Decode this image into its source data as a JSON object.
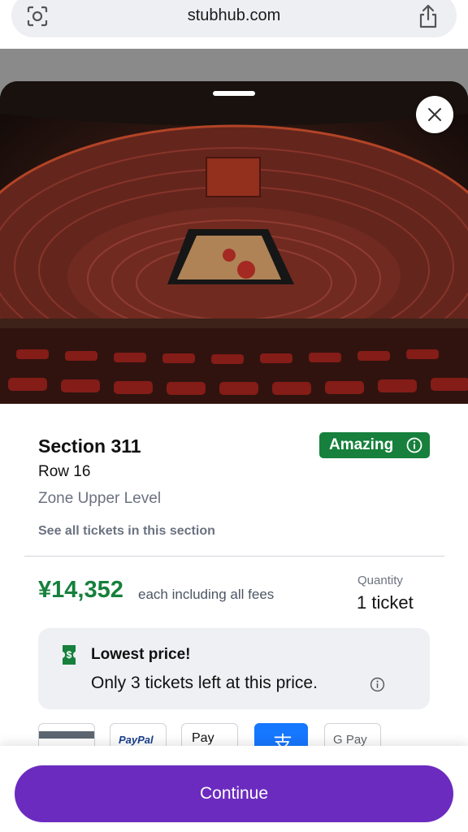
{
  "browser": {
    "url": "stubhub.com"
  },
  "listing": {
    "section": "Section 311",
    "badge": "Amazing",
    "row": "Row 16",
    "zone": "Zone Upper Level",
    "see_all_link": "See all tickets in this section"
  },
  "pricing": {
    "price": "¥14,352",
    "price_note": "each including all fees",
    "quantity_label": "Quantity",
    "quantity_value": "1 ticket"
  },
  "notice": {
    "title": "Lowest price!",
    "text": "Only 3 tickets left at this price."
  },
  "payment_methods": [
    {
      "name": "card",
      "label": ""
    },
    {
      "name": "paypal",
      "label": "PayPal"
    },
    {
      "name": "apple-pay",
      "label": " Pay"
    },
    {
      "name": "alipay",
      "label": "支"
    },
    {
      "name": "google-pay",
      "label": "G Pay"
    }
  ],
  "footer": {
    "continue_label": "Continue"
  },
  "colors": {
    "accent": "#6c2bbf",
    "price_green": "#16803c",
    "badge_green": "#16803c"
  }
}
